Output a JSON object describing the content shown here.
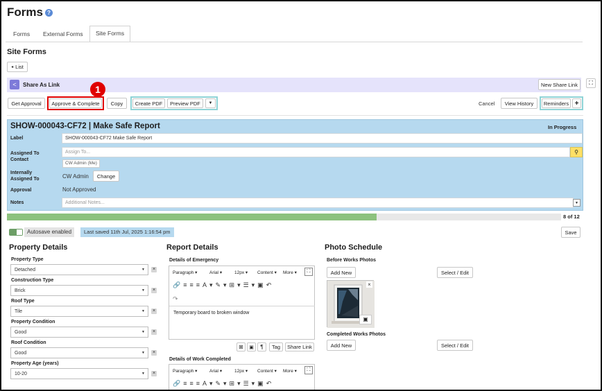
{
  "page": {
    "title": "Forms"
  },
  "tabs": [
    "Forms",
    "External Forms",
    "Site Forms"
  ],
  "subtitle": "Site Forms",
  "back_button": "List",
  "share": {
    "label": "Share As Link",
    "new_link": "New Share Link"
  },
  "toolbar": {
    "get_approval": "Get Approval",
    "approve_complete": "Approve & Complete",
    "copy": "Copy",
    "create_pdf": "Create PDF",
    "preview_pdf": "Preview PDF",
    "cancel": "Cancel",
    "view_history": "View History",
    "reminders": "Reminders",
    "plus": "+",
    "callout": "1"
  },
  "form": {
    "title": "SHOW-000043-CF72 | Make Safe Report",
    "status": "In Progress",
    "label_label": "Label",
    "label_value": "SHOW-000043-CF72 Make Safe Report",
    "assigned_contact_label": "Assigned To Contact",
    "assign_placeholder": "Assign To...",
    "contact_chip": "CW Admin (Me)",
    "internal_label": "Internally Assigned To",
    "internal_value": "CW Admin",
    "change": "Change",
    "approval_label": "Approval",
    "approval_value": "Not Approved",
    "notes_label": "Notes",
    "notes_placeholder": "Additional Notes..."
  },
  "progress": {
    "label": "8 of 12",
    "fraction": 0.6667
  },
  "autosave": {
    "label": "Autosave enabled",
    "saved": "Last saved 11th Jul, 2025 1:16:54 pm",
    "save": "Save"
  },
  "property": {
    "title": "Property Details",
    "fields": [
      {
        "label": "Property Type",
        "value": "Detached"
      },
      {
        "label": "Construction Type",
        "value": "Brick"
      },
      {
        "label": "Roof Type",
        "value": "Tile"
      },
      {
        "label": "Property Condition",
        "value": "Good"
      },
      {
        "label": "Roof Condition",
        "value": "Good"
      },
      {
        "label": "Property Age (years)",
        "value": "10-20"
      }
    ]
  },
  "report": {
    "title": "Report Details",
    "emergency_label": "Details of Emergency",
    "emergency_text": "Temporary board to broken window",
    "work_label": "Details of Work Completed",
    "editor": {
      "paragraph": "Paragraph",
      "font": "Arial",
      "size": "12px",
      "content": "Content",
      "more": "More"
    },
    "tag": "Tag",
    "share_link": "Share Link"
  },
  "photos": {
    "title": "Photo Schedule",
    "before_label": "Before Works Photos",
    "completed_label": "Completed Works Photos",
    "add_new": "Add New",
    "select_edit": "Select / Edit"
  },
  "colors": {
    "accent": "#b6d9ef",
    "progress": "#8dc27e",
    "highlight": "#e00000",
    "teal": "#8fd3d6"
  }
}
